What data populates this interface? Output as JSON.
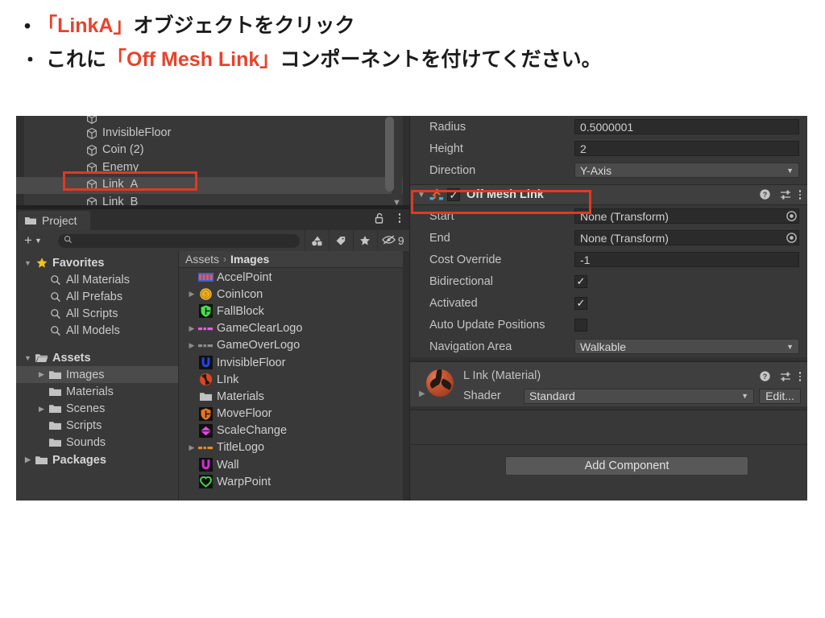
{
  "slide": {
    "bullet": "・",
    "line1": [
      {
        "t": "「LinkA」",
        "red": true
      },
      {
        "t": "オブジェクトをクリック",
        "red": false
      }
    ],
    "line2": [
      {
        "t": "これに",
        "red": false
      },
      {
        "t": "「Off Mesh Link」",
        "red": true
      },
      {
        "t": "コンポーネントを付けてください。",
        "red": false
      }
    ],
    "accent_red": "#e8422a",
    "text_color": "#1b1b1b"
  },
  "hierarchy": {
    "items": [
      {
        "label": "",
        "clipped": true,
        "selected": false
      },
      {
        "label": "InvisibleFloor",
        "clipped": false,
        "selected": false
      },
      {
        "label": "Coin (2)",
        "clipped": false,
        "selected": false
      },
      {
        "label": "Enemy",
        "clipped": false,
        "selected": false
      },
      {
        "label": "Link_A",
        "clipped": false,
        "selected": true
      },
      {
        "label": "Link_B",
        "clipped": false,
        "selected": false
      }
    ],
    "highlight_color": "#e03a20",
    "scroll_down_glyph": "▼"
  },
  "project": {
    "tab_label": "Project",
    "tab_icon": "folder-icon",
    "lock_icon": "lock-open-icon",
    "menu_icon": "kebab-menu-icon",
    "add_label": "+",
    "add_caret": "▼",
    "search_placeholder": "",
    "search_value": "",
    "search_icon": "search-icon",
    "toolbar_buttons": [
      {
        "name": "filter-by-type-icon"
      },
      {
        "name": "filter-by-label-icon"
      },
      {
        "name": "filter-by-favorite-icon"
      }
    ],
    "hidden_items_count": "9",
    "hidden_items_icon": "eye-hidden-icon",
    "tree": [
      {
        "label": "Favorites",
        "icon": "star-icon",
        "arrow": "▼",
        "indent": 0,
        "bold": true,
        "selected": false
      },
      {
        "label": "All Materials",
        "icon": "search-icon",
        "arrow": "",
        "indent": 1,
        "bold": false,
        "selected": false
      },
      {
        "label": "All Prefabs",
        "icon": "search-icon",
        "arrow": "",
        "indent": 1,
        "bold": false,
        "selected": false
      },
      {
        "label": "All Scripts",
        "icon": "search-icon",
        "arrow": "",
        "indent": 1,
        "bold": false,
        "selected": false
      },
      {
        "label": "All Models",
        "icon": "search-icon",
        "arrow": "",
        "indent": 1,
        "bold": false,
        "selected": false
      },
      {
        "label": "Assets",
        "icon": "folder-open-icon",
        "arrow": "▼",
        "indent": 0,
        "bold": true,
        "selected": false
      },
      {
        "label": "Images",
        "icon": "folder-icon",
        "arrow": "▶",
        "indent": 1,
        "bold": false,
        "selected": true
      },
      {
        "label": "Materials",
        "icon": "folder-icon",
        "arrow": "",
        "indent": 1,
        "bold": false,
        "selected": false
      },
      {
        "label": "Scenes",
        "icon": "folder-icon",
        "arrow": "▶",
        "indent": 1,
        "bold": false,
        "selected": false
      },
      {
        "label": "Scripts",
        "icon": "folder-icon",
        "arrow": "",
        "indent": 1,
        "bold": false,
        "selected": false
      },
      {
        "label": "Sounds",
        "icon": "folder-icon",
        "arrow": "",
        "indent": 1,
        "bold": false,
        "selected": false
      },
      {
        "label": "Packages",
        "icon": "folder-icon",
        "arrow": "▶",
        "indent": 0,
        "bold": true,
        "selected": false
      }
    ],
    "breadcrumb": {
      "root": "Assets",
      "sep": "›",
      "current": "Images"
    },
    "assets": [
      {
        "label": "AccelPoint",
        "arrow": "",
        "icon": "sprite-accelpoint-icon",
        "color": "#3f5fd8",
        "accent": "#e85b4a",
        "shape": "strip"
      },
      {
        "label": "CoinIcon",
        "arrow": "▶",
        "icon": "sprite-coin-icon",
        "color": "#f0b429",
        "accent": "#c48a13",
        "shape": "circle"
      },
      {
        "label": "FallBlock",
        "arrow": "",
        "icon": "sprite-fallblock-icon",
        "color": "#46e04a",
        "accent": "#1b1b1b",
        "shape": "shield"
      },
      {
        "label": "GameClearLogo",
        "arrow": "▶",
        "icon": "sprite-gameclearlogo-icon",
        "color": "#e45fe0",
        "accent": "#e45fe0",
        "shape": "strip"
      },
      {
        "label": "GameOverLogo",
        "arrow": "▶",
        "icon": "sprite-gameoverlogo-icon",
        "color": "#8e8e8e",
        "accent": "#8e8e8e",
        "shape": "strip"
      },
      {
        "label": "InvisibleFloor",
        "arrow": "",
        "icon": "sprite-invisiblefloor-icon",
        "color": "#2244e8",
        "accent": "#2244e8",
        "shape": "horseshoe"
      },
      {
        "label": "LInk",
        "arrow": "",
        "icon": "sprite-link-icon",
        "color": "#e0441f",
        "accent": "#1b1b1b",
        "shape": "circle"
      },
      {
        "label": "Materials",
        "arrow": "",
        "icon": "folder-icon",
        "color": "#b9b9b9",
        "accent": "#b9b9b9",
        "shape": "folder"
      },
      {
        "label": "MoveFloor",
        "arrow": "",
        "icon": "sprite-movefloor-icon",
        "color": "#e8731f",
        "accent": "#1b1b1b",
        "shape": "shield"
      },
      {
        "label": "ScaleChange",
        "arrow": "",
        "icon": "sprite-scalechange-icon",
        "color": "#e446e4",
        "accent": "#1b1b1b",
        "shape": "diamond"
      },
      {
        "label": "TitleLogo",
        "arrow": "▶",
        "icon": "sprite-titlelogo-icon",
        "color": "#e08a2a",
        "accent": "#e08a2a",
        "shape": "strip"
      },
      {
        "label": "Wall",
        "arrow": "",
        "icon": "sprite-wall-icon",
        "color": "#cf2fd6",
        "accent": "#cf2fd6",
        "shape": "horseshoe"
      },
      {
        "label": "WarpPoint",
        "arrow": "",
        "icon": "sprite-warppoint-icon",
        "color": "#46e04a",
        "accent": "#46e04a",
        "shape": "heart"
      }
    ]
  },
  "inspector": {
    "collider_fields": [
      {
        "label": "Radius",
        "value": "0.5000001",
        "type": "text"
      },
      {
        "label": "Height",
        "value": "2",
        "type": "text"
      },
      {
        "label": "Direction",
        "value": "Y-Axis",
        "type": "popup"
      }
    ],
    "off_mesh_link": {
      "foldout": "▼",
      "icon": "off-mesh-link-icon",
      "enabled": true,
      "check_glyph": "✓",
      "title": "Off Mesh Link",
      "help_icon": "help-icon",
      "preset_icon": "preset-sliders-icon",
      "menu_icon": "kebab-menu-icon",
      "highlight_color": "#e03a20",
      "fields": [
        {
          "label": "Start",
          "value": "None (Transform)",
          "type": "object"
        },
        {
          "label": "End",
          "value": "None (Transform)",
          "type": "object"
        },
        {
          "label": "Cost Override",
          "value": "-1",
          "type": "text"
        },
        {
          "label": "Bidirectional",
          "value": true,
          "type": "checkbox"
        },
        {
          "label": "Activated",
          "value": true,
          "type": "checkbox"
        },
        {
          "label": "Auto Update Positions",
          "value": false,
          "type": "checkbox"
        },
        {
          "label": "Navigation Area",
          "value": "Walkable",
          "type": "popup"
        }
      ]
    },
    "material": {
      "foldout": "▶",
      "title": "L Ink (Material)",
      "preview_icon": "material-sphere-preview",
      "help_icon": "help-icon",
      "preset_icon": "preset-sliders-icon",
      "menu_icon": "kebab-menu-icon",
      "shader_label": "Shader",
      "shader_value": "Standard",
      "shader_caret": "▼",
      "edit_label": "Edit..."
    },
    "add_component_label": "Add Component"
  }
}
